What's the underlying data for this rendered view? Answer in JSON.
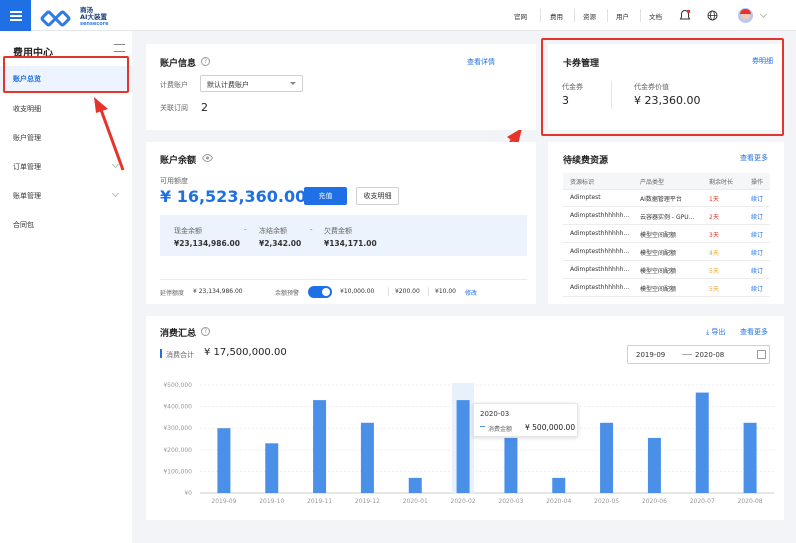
{
  "topbar": {
    "logo_line1": "商汤",
    "logo_line2": "AI大装置",
    "logo_line3": "sensecore",
    "nav": [
      "官网",
      "费用",
      "资源",
      "用户",
      "文档"
    ]
  },
  "sidebar": {
    "title": "费用中心",
    "items": [
      {
        "label": "账户总览"
      },
      {
        "label": "收支明细"
      },
      {
        "label": "账户管理"
      },
      {
        "label": "订单管理"
      },
      {
        "label": "账单管理"
      },
      {
        "label": "合同包"
      }
    ]
  },
  "account": {
    "title": "账户信息",
    "detail_link": "查看详情",
    "billing_label": "计费账户",
    "billing_value": "默认计费账户",
    "sub_label": "关联订阅",
    "sub_value": "2"
  },
  "coupon": {
    "title": "卡券管理",
    "link": "券明细",
    "voucher_label": "代金券",
    "voucher_value": "3",
    "value_label": "代金券价值",
    "value_value": "¥ 23,360.00"
  },
  "balance": {
    "title": "账户余额",
    "available_label": "可用额度",
    "available_value": "¥ 16,523,360.00",
    "recharge": "充值",
    "detail": "收支明细",
    "cash_label": "现金余额",
    "cash_value": "¥23,134,986.00",
    "frozen_label": "冻结余额",
    "frozen_value": "¥2,342.00",
    "owed_label": "欠费金额",
    "owed_value": "¥134,171.00",
    "credit_label": "延停额度",
    "credit_value": "¥ 23,134,986.00",
    "alert_label": "余额预警",
    "alert_values": [
      "¥10,000.00",
      "¥200.00",
      "¥10.00"
    ],
    "modify": "修改"
  },
  "renew": {
    "title": "待续费资源",
    "more": "查看更多",
    "headers": [
      "资源标识",
      "产品类型",
      "剩余时长",
      "操作"
    ],
    "rows": [
      {
        "id": "Adimptest",
        "type": "AI数据管理平台",
        "remain": "1天",
        "color": "#e5342a",
        "op": "续订"
      },
      {
        "id": "Adimptesthhhhhh...",
        "type": "云容器实例 - GPU...",
        "remain": "2天",
        "color": "#e5342a",
        "op": "续订"
      },
      {
        "id": "Adimptesthhhhhh...",
        "type": "模型空间配额",
        "remain": "3天",
        "color": "#e5342a",
        "op": "续订"
      },
      {
        "id": "Adimptesthhhhhh...",
        "type": "模型空间配额",
        "remain": "4天",
        "color": "#f5a623",
        "op": "续订"
      },
      {
        "id": "Adimptesthhhhhh...",
        "type": "模型空间配额",
        "remain": "5天",
        "color": "#f5a623",
        "op": "续订"
      },
      {
        "id": "Adimptesthhhhhh...",
        "type": "模型空间配额",
        "remain": "5天",
        "color": "#f5a623",
        "op": "续订"
      }
    ]
  },
  "summary": {
    "title": "消费汇总",
    "export": "导出",
    "more": "查看更多",
    "total_label": "消费合计",
    "total_value": "¥ 17,500,000.00",
    "date_from": "2019-09",
    "date_to": "2020-08",
    "tooltip_title": "2020-03",
    "tooltip_label": "消费金额",
    "tooltip_value": "¥ 500,000.00"
  },
  "chart_data": {
    "type": "bar",
    "categories": [
      "2019-09",
      "2019-10",
      "2019-11",
      "2019-12",
      "2020-01",
      "2020-02",
      "2020-03",
      "2020-04",
      "2020-05",
      "2020-06",
      "2020-07",
      "2020-08"
    ],
    "values": [
      300000,
      230000,
      430000,
      325000,
      70000,
      430000,
      255000,
      70000,
      325000,
      255000,
      465000,
      325000
    ],
    "yticks": [
      "¥0",
      "¥100,000",
      "¥200,000",
      "¥300,000",
      "¥400,000",
      "¥500,000"
    ],
    "ylim": [
      0,
      500000
    ],
    "highlight_index": 5,
    "bar_color": "#4a90e8"
  }
}
